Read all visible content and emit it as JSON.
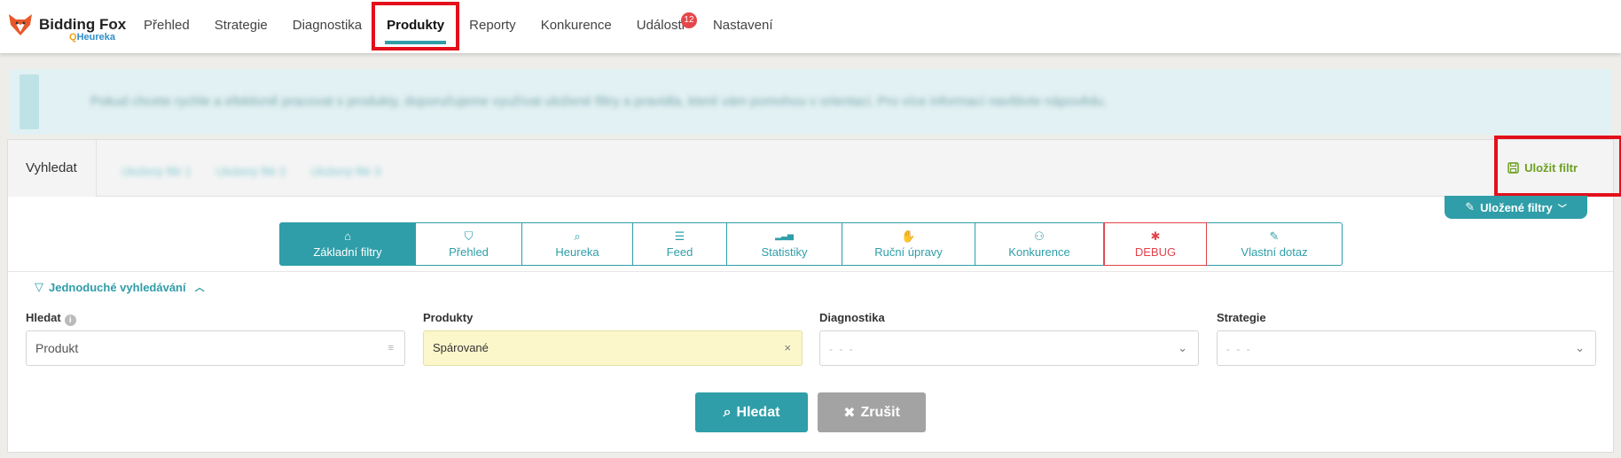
{
  "logo": {
    "title": "Bidding Fox",
    "sub_prefix": "Q",
    "sub": "Heureka"
  },
  "nav": [
    {
      "label": "Přehled"
    },
    {
      "label": "Strategie"
    },
    {
      "label": "Diagnostika"
    },
    {
      "label": "Produkty",
      "active": true
    },
    {
      "label": "Reporty"
    },
    {
      "label": "Konkurence"
    },
    {
      "label": "Události",
      "badge": "12"
    },
    {
      "label": "Nastavení"
    }
  ],
  "info": {
    "text": "Pokud chcete rychle a efektivně pracovat s produkty, doporučujeme využívat uložené filtry a pravidla, které vám pomohou v orientaci. Pro více informací navštivte nápovědu."
  },
  "search": {
    "label": "Vyhledat",
    "blur_links": [
      "Uložený filtr 1",
      "Uložený filtr 2",
      "Uložený filtr 3"
    ],
    "save_filter": "Uložit filtr",
    "saved_filters": "Uložené filtry"
  },
  "tabs": [
    {
      "label": "Základní filtry",
      "icon": "home-icon",
      "active": true
    },
    {
      "label": "Přehled",
      "icon": "shield-icon"
    },
    {
      "label": "Heureka",
      "icon": "search-icon"
    },
    {
      "label": "Feed",
      "icon": "list-icon"
    },
    {
      "label": "Statistiky",
      "icon": "chart-icon"
    },
    {
      "label": "Ruční úpravy",
      "icon": "hand-icon"
    },
    {
      "label": "Konkurence",
      "icon": "group-icon"
    },
    {
      "label": "DEBUG",
      "icon": "bug-icon"
    },
    {
      "label": "Vlastní dotaz",
      "icon": "pencil-icon"
    }
  ],
  "simple_search": {
    "label": "Jednoduché vyhledávání"
  },
  "fields": {
    "hledat": {
      "label": "Hledat",
      "placeholder": "Produkt"
    },
    "produkty": {
      "label": "Produkty",
      "value": "Spárované"
    },
    "diagnostika": {
      "label": "Diagnostika",
      "value": "- - -"
    },
    "strategie": {
      "label": "Strategie",
      "value": "- - -"
    }
  },
  "buttons": {
    "search": "Hledat",
    "cancel": "Zrušit"
  },
  "colors": {
    "accent": "#2f9ea8",
    "save": "#6c9f22",
    "debug": "#e1434a",
    "highlight": "#e3101c"
  }
}
